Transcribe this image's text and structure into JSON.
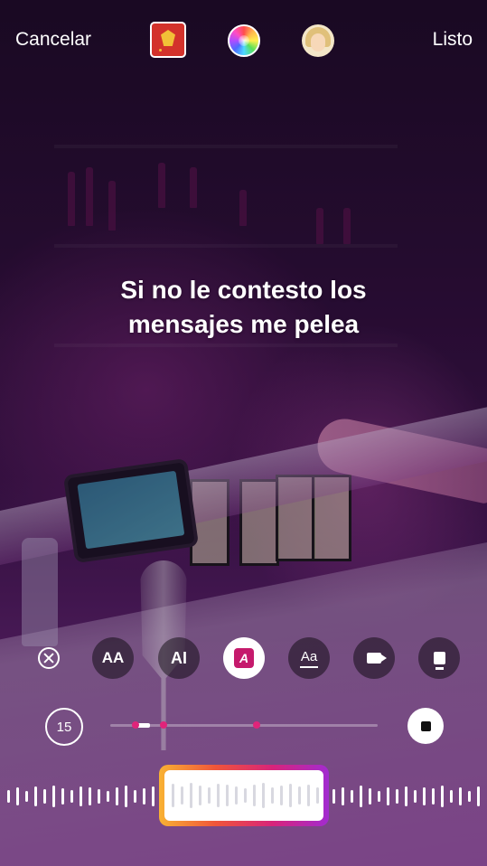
{
  "topbar": {
    "cancel_label": "Cancelar",
    "done_label": "Listo",
    "icons": [
      "sticker-icon",
      "color-wheel-icon",
      "avatar-icon"
    ]
  },
  "caption": {
    "line1": "Si no le contesto los",
    "line2": "mensajes me pelea"
  },
  "tools": {
    "aa_label": "AA",
    "ai_label": "AI",
    "a_label": "A",
    "aa_line_label": "Aa",
    "icons": [
      "close-circle-icon",
      "text-size-icon",
      "text-align-icon",
      "text-style-icon",
      "text-underline-icon",
      "video-icon",
      "sticker-display-icon"
    ]
  },
  "timeline": {
    "duration_label": "15",
    "icons": [
      "stop-icon"
    ]
  },
  "colors": {
    "accent_magenta": "#d8247a",
    "selector_gradient": [
      "#f9b233",
      "#f0553a",
      "#d8247a",
      "#a22bd0"
    ]
  }
}
